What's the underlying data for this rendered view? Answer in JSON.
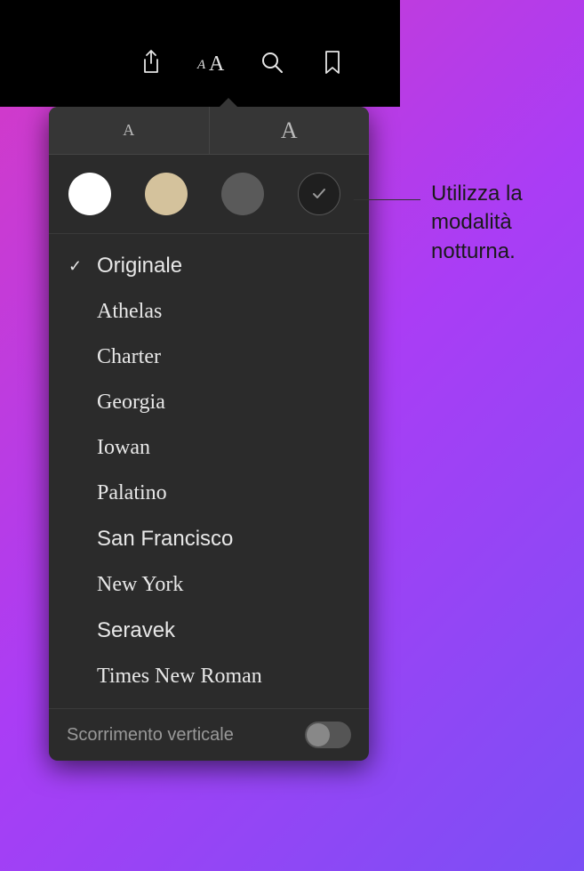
{
  "toolbar": {
    "share": "share-icon",
    "appearance": "appearance-icon",
    "search": "search-icon",
    "bookmark": "bookmark-icon"
  },
  "fontSize": {
    "smallLabel": "A",
    "largeLabel": "A"
  },
  "themes": {
    "white": "#ffffff",
    "sepia": "#d4c29c",
    "gray": "#5a5a5a",
    "night": "#1f1f1f",
    "nightCheck": "✓"
  },
  "fonts": [
    {
      "label": "Originale",
      "class": "font-originale",
      "selected": true
    },
    {
      "label": "Athelas",
      "class": "font-athelas",
      "selected": false
    },
    {
      "label": "Charter",
      "class": "font-charter",
      "selected": false
    },
    {
      "label": "Georgia",
      "class": "font-georgia",
      "selected": false
    },
    {
      "label": "Iowan",
      "class": "font-iowan",
      "selected": false
    },
    {
      "label": "Palatino",
      "class": "font-palatino",
      "selected": false
    },
    {
      "label": "San Francisco",
      "class": "font-sanfrancisco",
      "selected": false
    },
    {
      "label": "New York",
      "class": "font-newyork",
      "selected": false
    },
    {
      "label": "Seravek",
      "class": "font-seravek",
      "selected": false
    },
    {
      "label": "Times New Roman",
      "class": "font-times",
      "selected": false
    }
  ],
  "scroll": {
    "label": "Scorrimento verticale",
    "enabled": false
  },
  "callout": {
    "text": "Utilizza la modalità notturna."
  }
}
